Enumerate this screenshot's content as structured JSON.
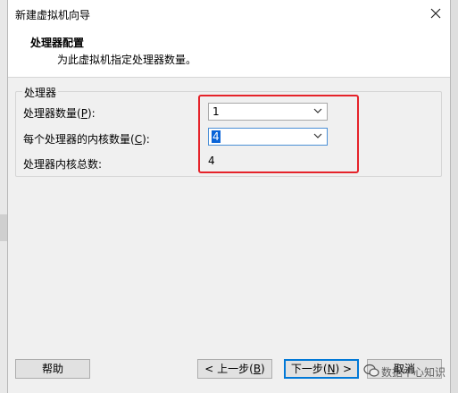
{
  "window": {
    "title": "新建虚拟机向导"
  },
  "header": {
    "title": "处理器配置",
    "subtitle": "为此虚拟机指定处理器数量。"
  },
  "group": {
    "label": "处理器",
    "processor_count": {
      "label_pre": "处理器数量(",
      "accel": "P",
      "label_post": "):",
      "value": "1"
    },
    "cores_per_processor": {
      "label_pre": "每个处理器的内核数量(",
      "accel": "C",
      "label_post": "):",
      "value": "4"
    },
    "total_cores": {
      "label": "处理器内核总数:",
      "value": "4"
    }
  },
  "buttons": {
    "help": "帮助",
    "back": {
      "pre": "< 上一步(",
      "accel": "B",
      "post": ")"
    },
    "next": {
      "pre": "下一步(",
      "accel": "N",
      "post": ") >"
    },
    "cancel": "取消"
  },
  "watermark": {
    "text": "数据中心知识"
  },
  "colors": {
    "highlight": "#e5232a",
    "focus": "#0078d7",
    "selection": "#0a64d8"
  }
}
